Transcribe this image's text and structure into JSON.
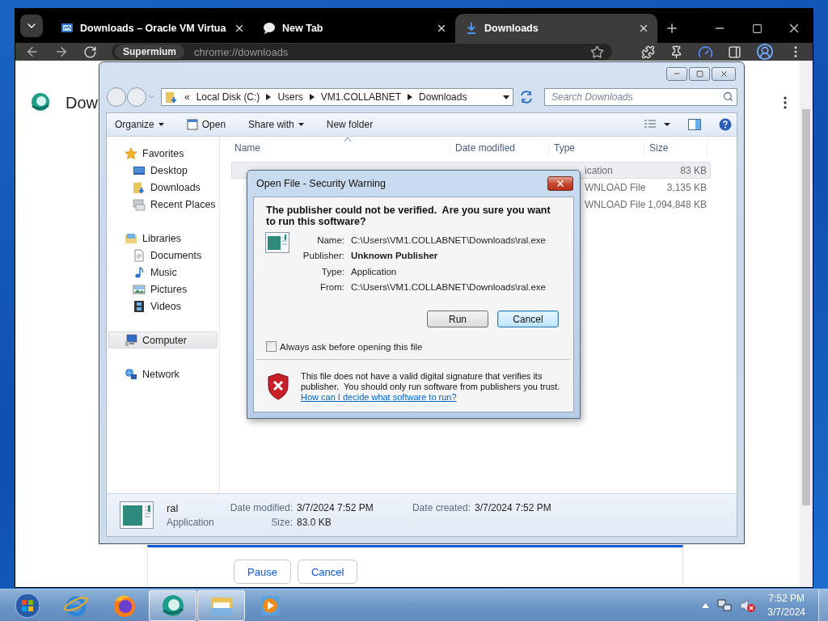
{
  "browser": {
    "tabs": [
      {
        "title": "Downloads – Oracle VM Virtua",
        "selected": false
      },
      {
        "title": "New Tab",
        "selected": false
      },
      {
        "title": "Downloads",
        "selected": true
      }
    ],
    "omnibox": {
      "chip": "Supermium",
      "url": "chrome://downloads"
    },
    "page": {
      "heading": "Dow",
      "buttons": [
        "Pause",
        "Cancel"
      ]
    }
  },
  "explorer": {
    "overflow": "«",
    "path": [
      "Local Disk (C:)",
      "Users",
      "VM1.COLLABNET",
      "Downloads"
    ],
    "search": {
      "placeholder": "Search Downloads"
    },
    "commands": [
      {
        "label": "Organize",
        "dropdown": true
      },
      {
        "label": "Open",
        "dropdown": false
      },
      {
        "label": "Share with",
        "dropdown": true
      },
      {
        "label": "New folder",
        "dropdown": false
      }
    ],
    "nav": [
      {
        "label": "Favorites",
        "selected": false,
        "children": [
          {
            "label": "Desktop",
            "selected": false
          },
          {
            "label": "Downloads",
            "selected": false
          },
          {
            "label": "Recent Places",
            "selected": false
          }
        ]
      },
      {
        "label": "Libraries",
        "selected": false,
        "children": [
          {
            "label": "Documents",
            "selected": false
          },
          {
            "label": "Music",
            "selected": false
          },
          {
            "label": "Pictures",
            "selected": false
          },
          {
            "label": "Videos",
            "selected": false
          }
        ]
      },
      {
        "label": "Computer",
        "selected": true
      },
      {
        "label": "Network",
        "selected": false
      }
    ],
    "columns": [
      "Name",
      "Date modified",
      "Type",
      "Size"
    ],
    "rows": [
      {
        "type": "ication",
        "size": "83 KB",
        "selected": true
      },
      {
        "type": "WNLOAD File",
        "size": "3,135 KB",
        "selected": false
      },
      {
        "type": "WNLOAD File",
        "size": "1,094,848 KB",
        "selected": false
      }
    ],
    "details": {
      "name": "ral",
      "type": "Application",
      "fields": [
        {
          "label": "Date modified:",
          "value": "3/7/2024 7:52 PM"
        },
        {
          "label": "Date created:",
          "value": "3/7/2024 7:52 PM"
        },
        {
          "label": "Size:",
          "value": "83.0 KB"
        }
      ]
    }
  },
  "dialog": {
    "title": "Open File - Security Warning",
    "heading": "The publisher could not be verified.  Are you sure you want to run this software?",
    "fields": [
      {
        "label": "Name:",
        "value": "C:\\Users\\VM1.COLLABNET\\Downloads\\ral.exe",
        "bold": false
      },
      {
        "label": "Publisher:",
        "value": "Unknown Publisher",
        "bold": true
      },
      {
        "label": "Type:",
        "value": "Application",
        "bold": false
      },
      {
        "label": "From:",
        "value": "C:\\Users\\VM1.COLLABNET\\Downloads\\ral.exe",
        "bold": false
      }
    ],
    "buttons": [
      {
        "label": "Run",
        "default": false
      },
      {
        "label": "Cancel",
        "default": true
      }
    ],
    "checkbox": {
      "label": "Always ask before opening this file",
      "checked": false
    },
    "warning": {
      "text": "This file does not have a valid digital signature that verifies its publisher.  You should only run software from publishers you trust.",
      "link": "How can I decide what software to run?"
    }
  },
  "taskbar": {
    "items": [
      {
        "kind": "start",
        "open": false
      },
      {
        "kind": "ie",
        "open": false
      },
      {
        "kind": "firefox",
        "open": false
      },
      {
        "kind": "supermium",
        "open": true
      },
      {
        "kind": "explorer",
        "open": true
      },
      {
        "kind": "media",
        "open": false
      }
    ],
    "clock": {
      "time": "7:52 PM",
      "date": "3/7/2024"
    }
  }
}
